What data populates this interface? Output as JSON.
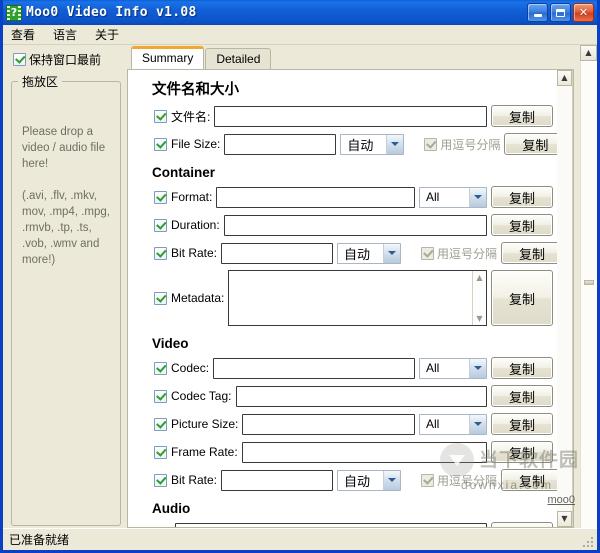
{
  "window": {
    "title": "Moo0 Video Info v1.08",
    "icon": "film-question-icon",
    "buttons": {
      "minimize": "minimize",
      "maximize": "maximize",
      "close": "close"
    }
  },
  "menubar": {
    "items": [
      {
        "label": "查看",
        "name": "menu-view"
      },
      {
        "label": "语言",
        "name": "menu-language"
      },
      {
        "label": "关于",
        "name": "menu-about"
      }
    ]
  },
  "left_pane": {
    "topmost": {
      "label": "保持窗口最前",
      "checked": true
    },
    "dropzone": {
      "title": "拖放区",
      "line1": "Please drop a video / audio file here!",
      "line2": "(.avi, .flv, .mkv, mov, .mp4, .mpg, .rmvb, .tp, .ts, .vob, .wmv and more!)"
    }
  },
  "tabs": [
    {
      "label": "Summary",
      "active": true,
      "name": "tab-summary"
    },
    {
      "label": "Detailed",
      "active": false,
      "name": "tab-detailed"
    }
  ],
  "labels": {
    "copy": "复制",
    "comma_separated": "用逗号分隔",
    "auto": "自动",
    "all": "All"
  },
  "sections": [
    {
      "name": "filename-and-size",
      "heading": "文件名和大小",
      "cjk": true,
      "rows": [
        {
          "name": "file-name",
          "label": "文件名:",
          "checked": true,
          "field": "wide",
          "combo": null,
          "comma": false,
          "copy": true
        },
        {
          "name": "file-size",
          "label": "File Size:",
          "checked": true,
          "field": "short",
          "combo": "自动",
          "comma": true,
          "copy": true
        }
      ]
    },
    {
      "name": "container",
      "heading": "Container",
      "cjk": false,
      "rows": [
        {
          "name": "container-format",
          "label": "Format:",
          "checked": true,
          "field": "wide",
          "combo": "All",
          "comma": false,
          "copy": true
        },
        {
          "name": "container-duration",
          "label": "Duration:",
          "checked": true,
          "field": "wide",
          "combo": null,
          "comma": false,
          "copy": true
        },
        {
          "name": "container-bit-rate",
          "label": "Bit Rate:",
          "checked": true,
          "field": "short",
          "combo": "自动",
          "comma": true,
          "copy": true
        },
        {
          "name": "container-metadata",
          "label": "Metadata:",
          "checked": true,
          "field": "textarea",
          "combo": null,
          "comma": false,
          "copy": true
        }
      ]
    },
    {
      "name": "video",
      "heading": "Video",
      "cjk": false,
      "rows": [
        {
          "name": "video-codec",
          "label": "Codec:",
          "checked": true,
          "field": "wide",
          "combo": "All",
          "comma": false,
          "copy": true
        },
        {
          "name": "video-codec-tag",
          "label": "Codec Tag:",
          "checked": true,
          "field": "wide",
          "combo": null,
          "comma": false,
          "copy": true
        },
        {
          "name": "video-picture-size",
          "label": "Picture Size:",
          "checked": true,
          "field": "wide",
          "combo": "All",
          "comma": false,
          "copy": true
        },
        {
          "name": "video-frame-rate",
          "label": "Frame Rate:",
          "checked": true,
          "field": "wide",
          "combo": null,
          "comma": false,
          "copy": true
        },
        {
          "name": "video-bit-rate",
          "label": "Bit Rate:",
          "checked": true,
          "field": "short",
          "combo": "自动",
          "comma": true,
          "copy": true
        }
      ]
    },
    {
      "name": "audio",
      "heading": "Audio",
      "cjk": false,
      "rows": [
        {
          "name": "audio-codec",
          "label": "",
          "checked": true,
          "field": "wide",
          "combo": null,
          "comma": false,
          "copy": true,
          "clipped": true
        }
      ]
    }
  ],
  "statusbar": {
    "text": "已准备就绪"
  },
  "watermark": {
    "cn": "当下软件园",
    "url": "downxia.com",
    "brand": "moo0"
  },
  "colors": {
    "titlebar_blue": "#0b52c8",
    "window_border": "#0a40c4",
    "face": "#ece9d8",
    "active_tab_accent": "#f0a830",
    "check_green": "#2f9e2f",
    "field_border": "#3a3a3a"
  }
}
